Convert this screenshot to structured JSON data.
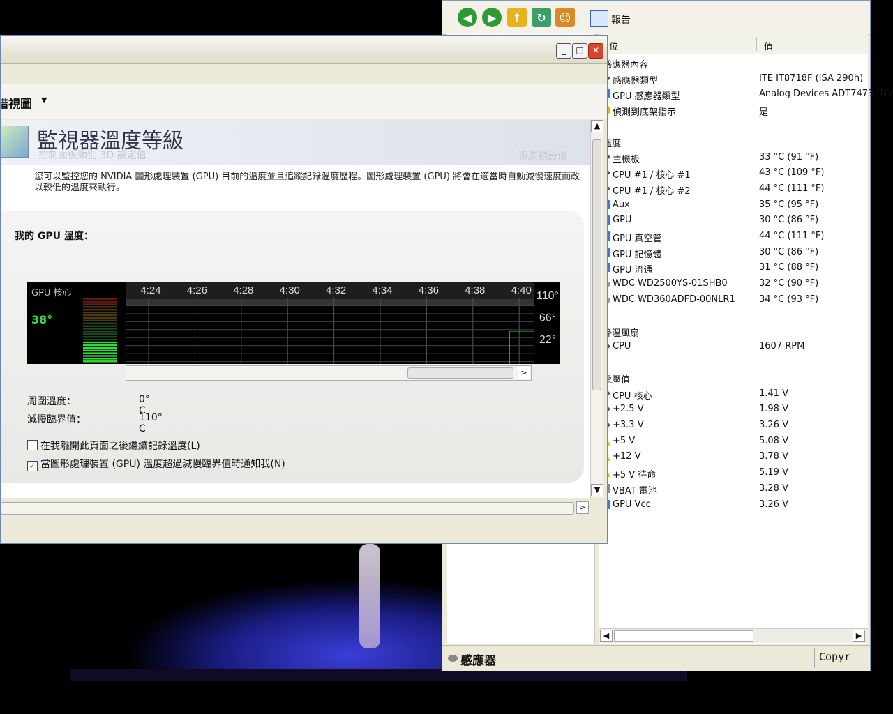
{
  "right_window": {
    "toolbar": {
      "report_label": "報告"
    },
    "columns": {
      "field": "欄位",
      "value": "值"
    },
    "rows": [
      {
        "type": "group",
        "icon": "sensor-icon",
        "name": "感應器內容",
        "value": ""
      },
      {
        "type": "item",
        "icon": "chip-icon",
        "name": "感應器類型",
        "value": "ITE IT8718F  (ISA 290h)"
      },
      {
        "type": "item",
        "icon": "gpu-icon",
        "name": "GPU 感應器類型",
        "value": "Analog Devices ADT7473  (NV"
      },
      {
        "type": "item",
        "icon": "bulb-icon",
        "name": "偵測到底架指示",
        "value": "是"
      },
      {
        "type": "spacer"
      },
      {
        "type": "group",
        "icon": "temperature-icon",
        "name": "溫度",
        "value": ""
      },
      {
        "type": "item",
        "icon": "chip-icon",
        "name": "主機板",
        "value": "33 °C  (91 °F)"
      },
      {
        "type": "item",
        "icon": "chip-icon",
        "name": "CPU #1 / 核心 #1",
        "value": "43 °C  (109 °F)"
      },
      {
        "type": "item",
        "icon": "chip-icon",
        "name": "CPU #1 / 核心 #2",
        "value": "44 °C  (111 °F)"
      },
      {
        "type": "item",
        "icon": "gpu-icon",
        "name": "Aux",
        "value": "35 °C  (95 °F)"
      },
      {
        "type": "item",
        "icon": "gpu-icon",
        "name": "GPU",
        "value": "30 °C  (86 °F)"
      },
      {
        "type": "item",
        "icon": "gpu-icon",
        "name": "GPU 真空管",
        "value": "44 °C  (111 °F)"
      },
      {
        "type": "item",
        "icon": "gpu-icon",
        "name": "GPU 記憶體",
        "value": "30 °C  (86 °F)"
      },
      {
        "type": "item",
        "icon": "gpu-icon",
        "name": "GPU 流通",
        "value": "31 °C  (88 °F)"
      },
      {
        "type": "item",
        "icon": "disk-icon",
        "name": "WDC WD2500YS-01SHB0",
        "value": "32 °C  (90 °F)"
      },
      {
        "type": "item",
        "icon": "disk-icon",
        "name": "WDC WD360ADFD-00NLR1",
        "value": "34 °C  (93 °F)"
      },
      {
        "type": "spacer"
      },
      {
        "type": "group",
        "icon": "fan-icon",
        "name": "降溫風扇",
        "value": ""
      },
      {
        "type": "item",
        "icon": "chip-icon",
        "name": "CPU",
        "value": "1607 RPM"
      },
      {
        "type": "spacer"
      },
      {
        "type": "group",
        "icon": "voltage-icon",
        "name": "電壓值",
        "value": ""
      },
      {
        "type": "item",
        "icon": "chip-icon",
        "name": "CPU 核心",
        "value": "1.41 V"
      },
      {
        "type": "item",
        "icon": "chip-icon",
        "name": "+2.5 V",
        "value": "1.98 V"
      },
      {
        "type": "item",
        "icon": "chip-icon",
        "name": "+3.3 V",
        "value": "3.26 V"
      },
      {
        "type": "item",
        "icon": "warning-icon",
        "name": "+5 V",
        "value": "5.08 V"
      },
      {
        "type": "item",
        "icon": "warning-icon",
        "name": "+12 V",
        "value": "3.78 V"
      },
      {
        "type": "item",
        "icon": "warning-icon",
        "name": "+5 V 待命",
        "value": "5.19 V"
      },
      {
        "type": "item",
        "icon": "battery-icon",
        "name": "VBAT 電池",
        "value": "3.28 V"
      },
      {
        "type": "item",
        "icon": "gpu-icon",
        "name": "GPU Vcc",
        "value": "3.26 V"
      }
    ],
    "status": {
      "section": "感應器",
      "copyright": "Copyr"
    }
  },
  "left_window": {
    "nav_title": "措視圖",
    "banner": {
      "title": "監視器溫度等級",
      "subtitle": "控制面板類別 3D 設定值",
      "reset": "還原預設值"
    },
    "description": "您可以監控您的 NVIDIA 圖形處理裝置 (GPU) 目前的溫度並且追蹤記錄溫度歷程。圖形處理裝置 (GPU) 將會在適當時自動減慢速度而改以較低的溫度來執行。",
    "panel_title": "我的 GPU 溫度：",
    "meter": {
      "label": "GPU 核心",
      "value": "38°",
      "fraction": 0.32
    },
    "chart_data": {
      "type": "line",
      "x_ticks": [
        "4:24",
        "4:26",
        "4:28",
        "4:30",
        "4:32",
        "4:34",
        "4:36",
        "4:38",
        "4:40"
      ],
      "y_ticks": [
        "110°",
        "66°",
        "22°"
      ],
      "ylim": [
        0,
        110
      ],
      "series": [
        {
          "x": [
            "4:40",
            "4:41"
          ],
          "y": [
            38,
            38
          ]
        }
      ],
      "grid": true
    },
    "ambient_label": "周圍溫度：",
    "ambient_value": "0° C",
    "threshold_label": "減慢臨界值：",
    "threshold_value": "110° C",
    "checkbox1": {
      "label": "在我離開此頁面之後繼續記錄溫度(L)",
      "checked": false
    },
    "checkbox2": {
      "label": "當圖形處理裝置 (GPU) 溫度超過減慢臨界值時通知我(N)",
      "checked": true
    }
  }
}
